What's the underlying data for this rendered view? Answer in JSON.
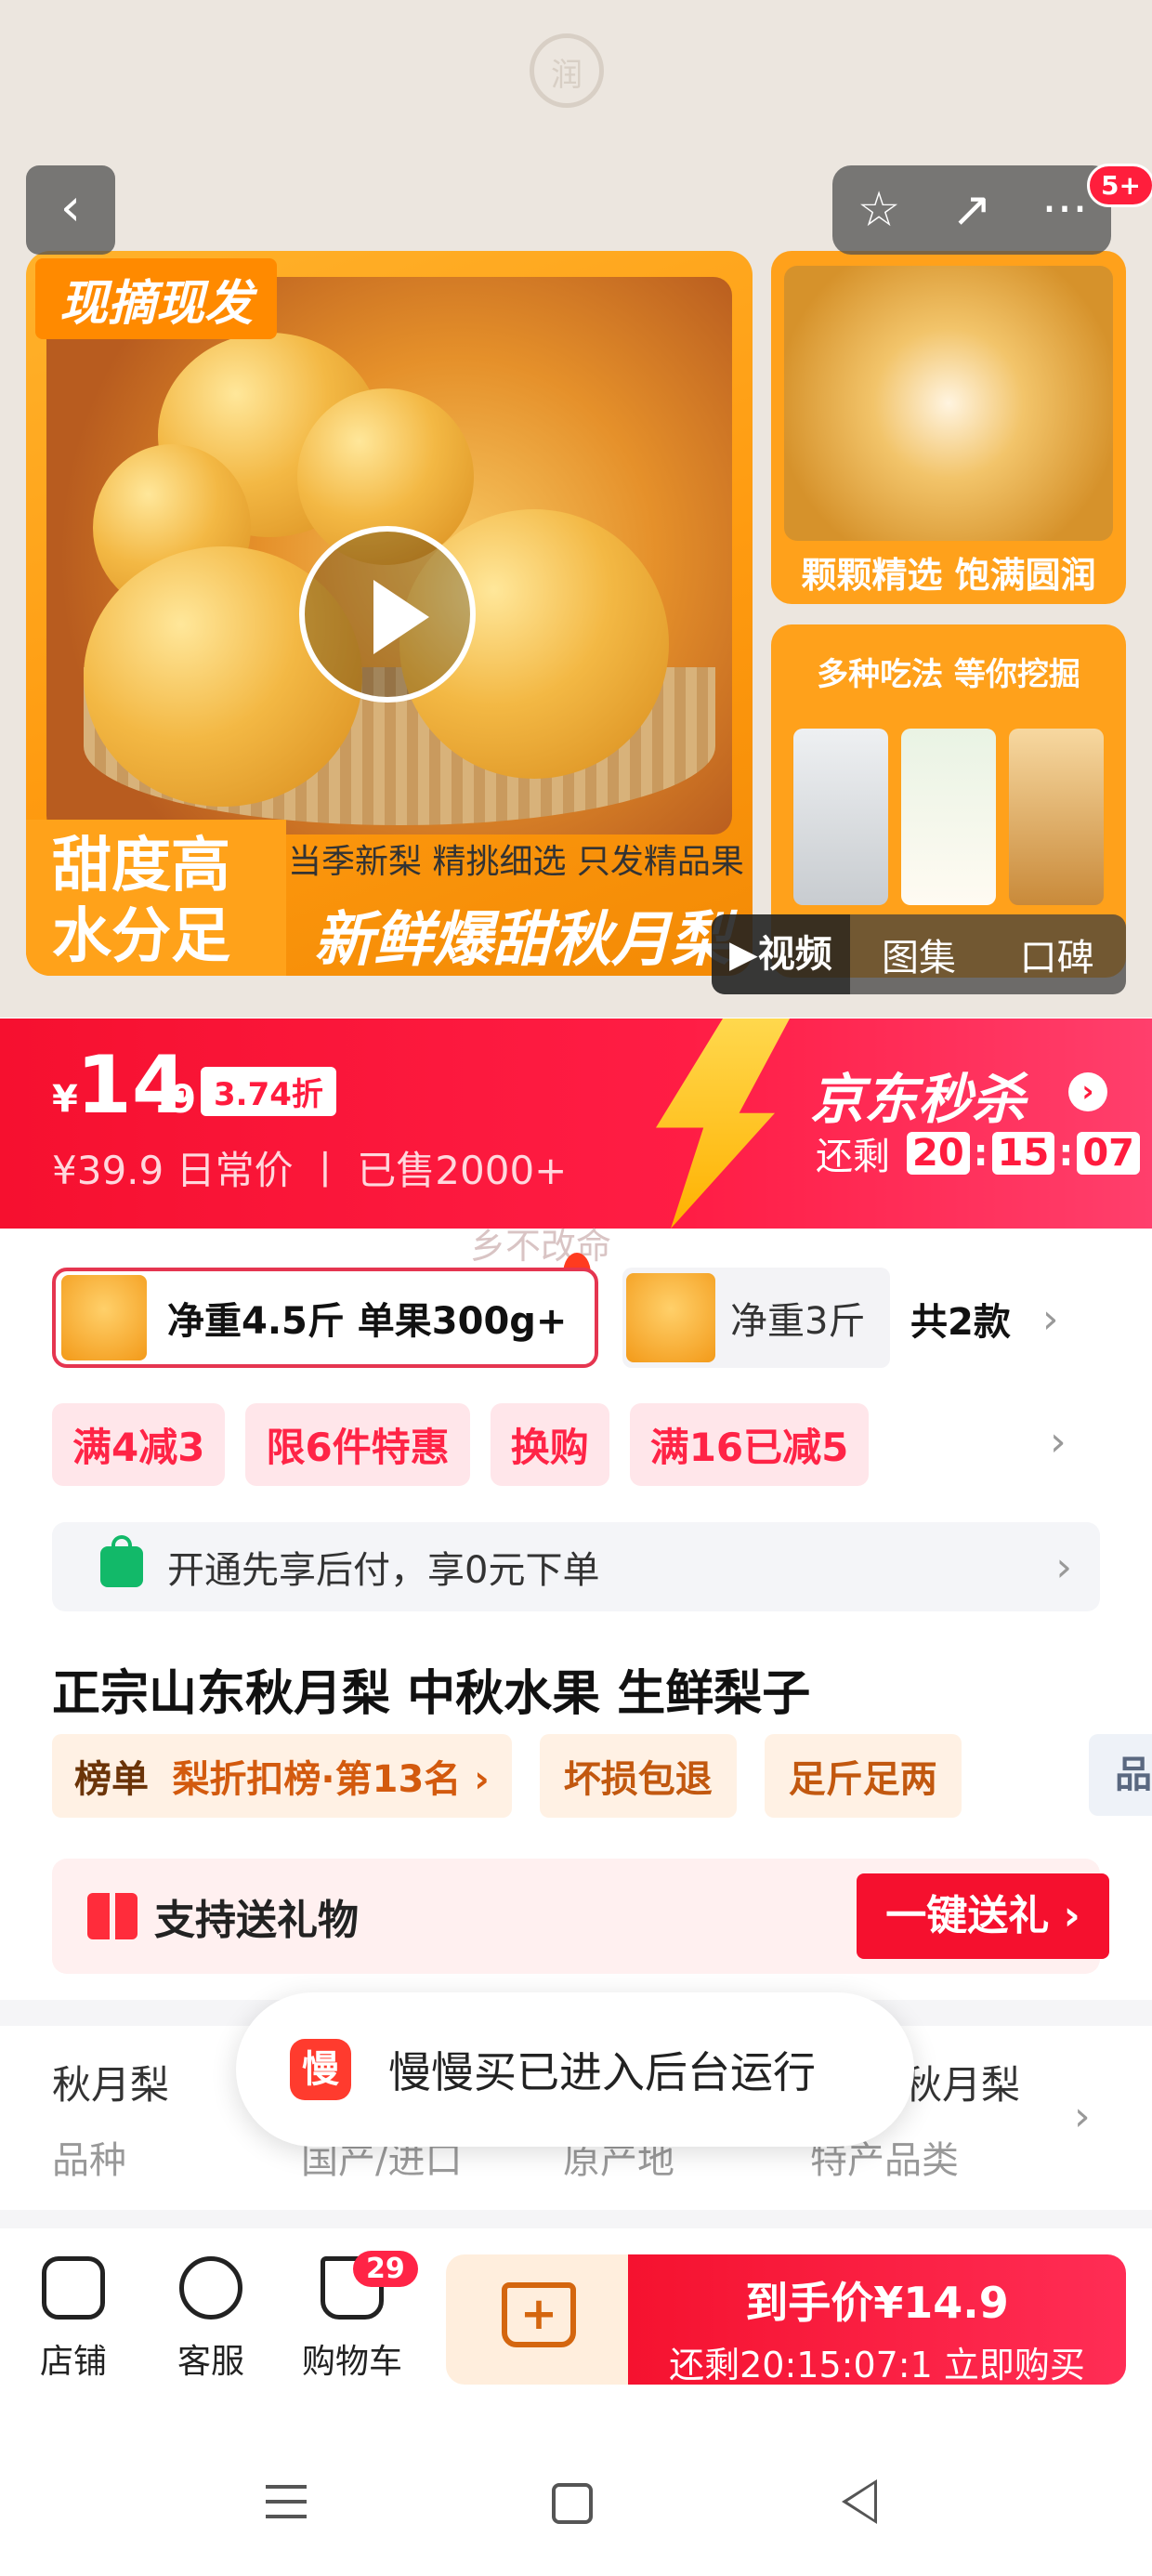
{
  "status_bar": {
    "carrier": "",
    "center_icon": "润"
  },
  "nav": {
    "back_icon": "‹",
    "star_icon": "☆",
    "share_icon": "↗",
    "more_icon": "···",
    "notif_badge": "5+"
  },
  "hero": {
    "tag": "现摘现发",
    "sweet_line1": "甜度高",
    "sweet_line2": "水分足",
    "sub_slogan": "当季新梨 精挑细选 只发精品果",
    "main_slogan": "新鲜爆甜秋月梨",
    "thumb1_caption": "颗颗精选 饱满圆润",
    "thumb2_title": "多种吃法 等你挖掘",
    "gallery_tabs": [
      "▶视频",
      "图集",
      "口碑"
    ]
  },
  "price": {
    "yen": "¥",
    "int": "14",
    "dec": ".9",
    "discount": "3.74折",
    "original": "¥39.9 日常价 丨 已售2000+",
    "promo_brand": "京东秒杀",
    "countdown_label": "还剩",
    "countdown": [
      "20",
      "15",
      "07"
    ]
  },
  "overlay_text": "乡不改命",
  "sku": {
    "selected": "净重4.5斤 单果300g+",
    "other": "净重3斤",
    "count": "共2款"
  },
  "promos": [
    "满4减3",
    "限6件特惠",
    "换购",
    "满16已减5"
  ],
  "paylater": "开通先享后付，享0元下单",
  "product_title": "正宗山东秋月梨  中秋水果 生鲜梨子",
  "tags": {
    "rank_prefix": "榜单",
    "rank_text": "梨折扣榜·第13名 ›",
    "t1": "坏损包退",
    "t2": "足斤足两",
    "t3": "品"
  },
  "gift": {
    "label": "支持送礼物",
    "button": "一键送礼 ›"
  },
  "specs": [
    {
      "value": "秋月梨",
      "label": "品种"
    },
    {
      "value": "",
      "label": "国产/进口"
    },
    {
      "value": "",
      "label": "原产地"
    },
    {
      "value": "秋月梨",
      "label": "特产品类"
    }
  ],
  "toast": {
    "logo": "慢",
    "text": "慢慢买已进入后台运行"
  },
  "bottom": {
    "store": "店铺",
    "service": "客服",
    "cart": "购物车",
    "cart_count": "29",
    "buy_price": "到手价¥14.9",
    "buy_sub": "还剩20:15:07:1 立即购买"
  }
}
